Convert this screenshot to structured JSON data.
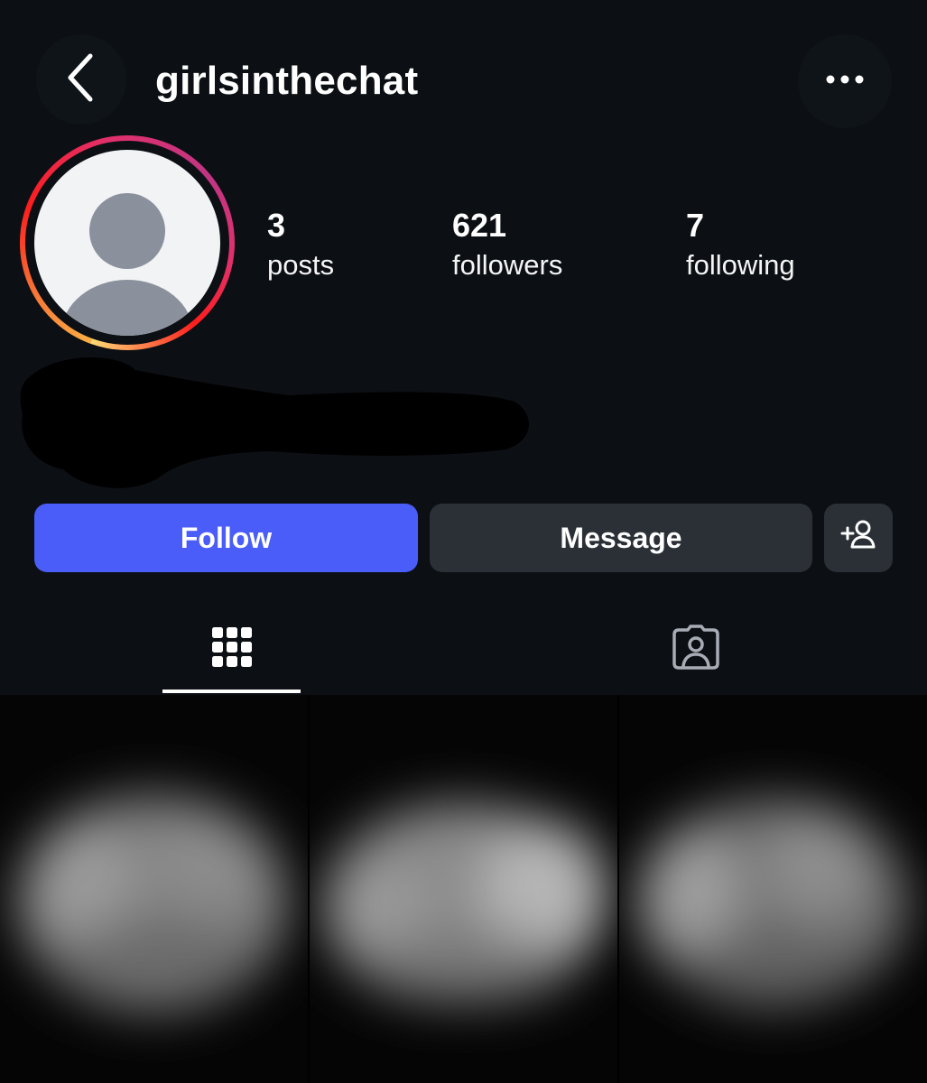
{
  "header": {
    "username": "girlsinthechat",
    "back_icon": "chevron-left-icon",
    "more_icon": "more-horizontal-icon"
  },
  "profile": {
    "avatar_icon": "default-avatar-icon",
    "stats": [
      {
        "value": "3",
        "label": "posts"
      },
      {
        "value": "621",
        "label": "followers"
      },
      {
        "value": "7",
        "label": "following"
      }
    ]
  },
  "actions": {
    "follow_label": "Follow",
    "message_label": "Message",
    "add_friend_icon": "add-person-icon"
  },
  "tabs": [
    {
      "icon": "grid-icon",
      "selected": true
    },
    {
      "icon": "tagged-person-icon",
      "selected": false
    }
  ],
  "colors": {
    "background": "#0c1014",
    "follow_button": "#4a5df9",
    "secondary_button": "#2b3036",
    "story_ring_start": "#fcaf45",
    "story_ring_end": "#c13584"
  }
}
